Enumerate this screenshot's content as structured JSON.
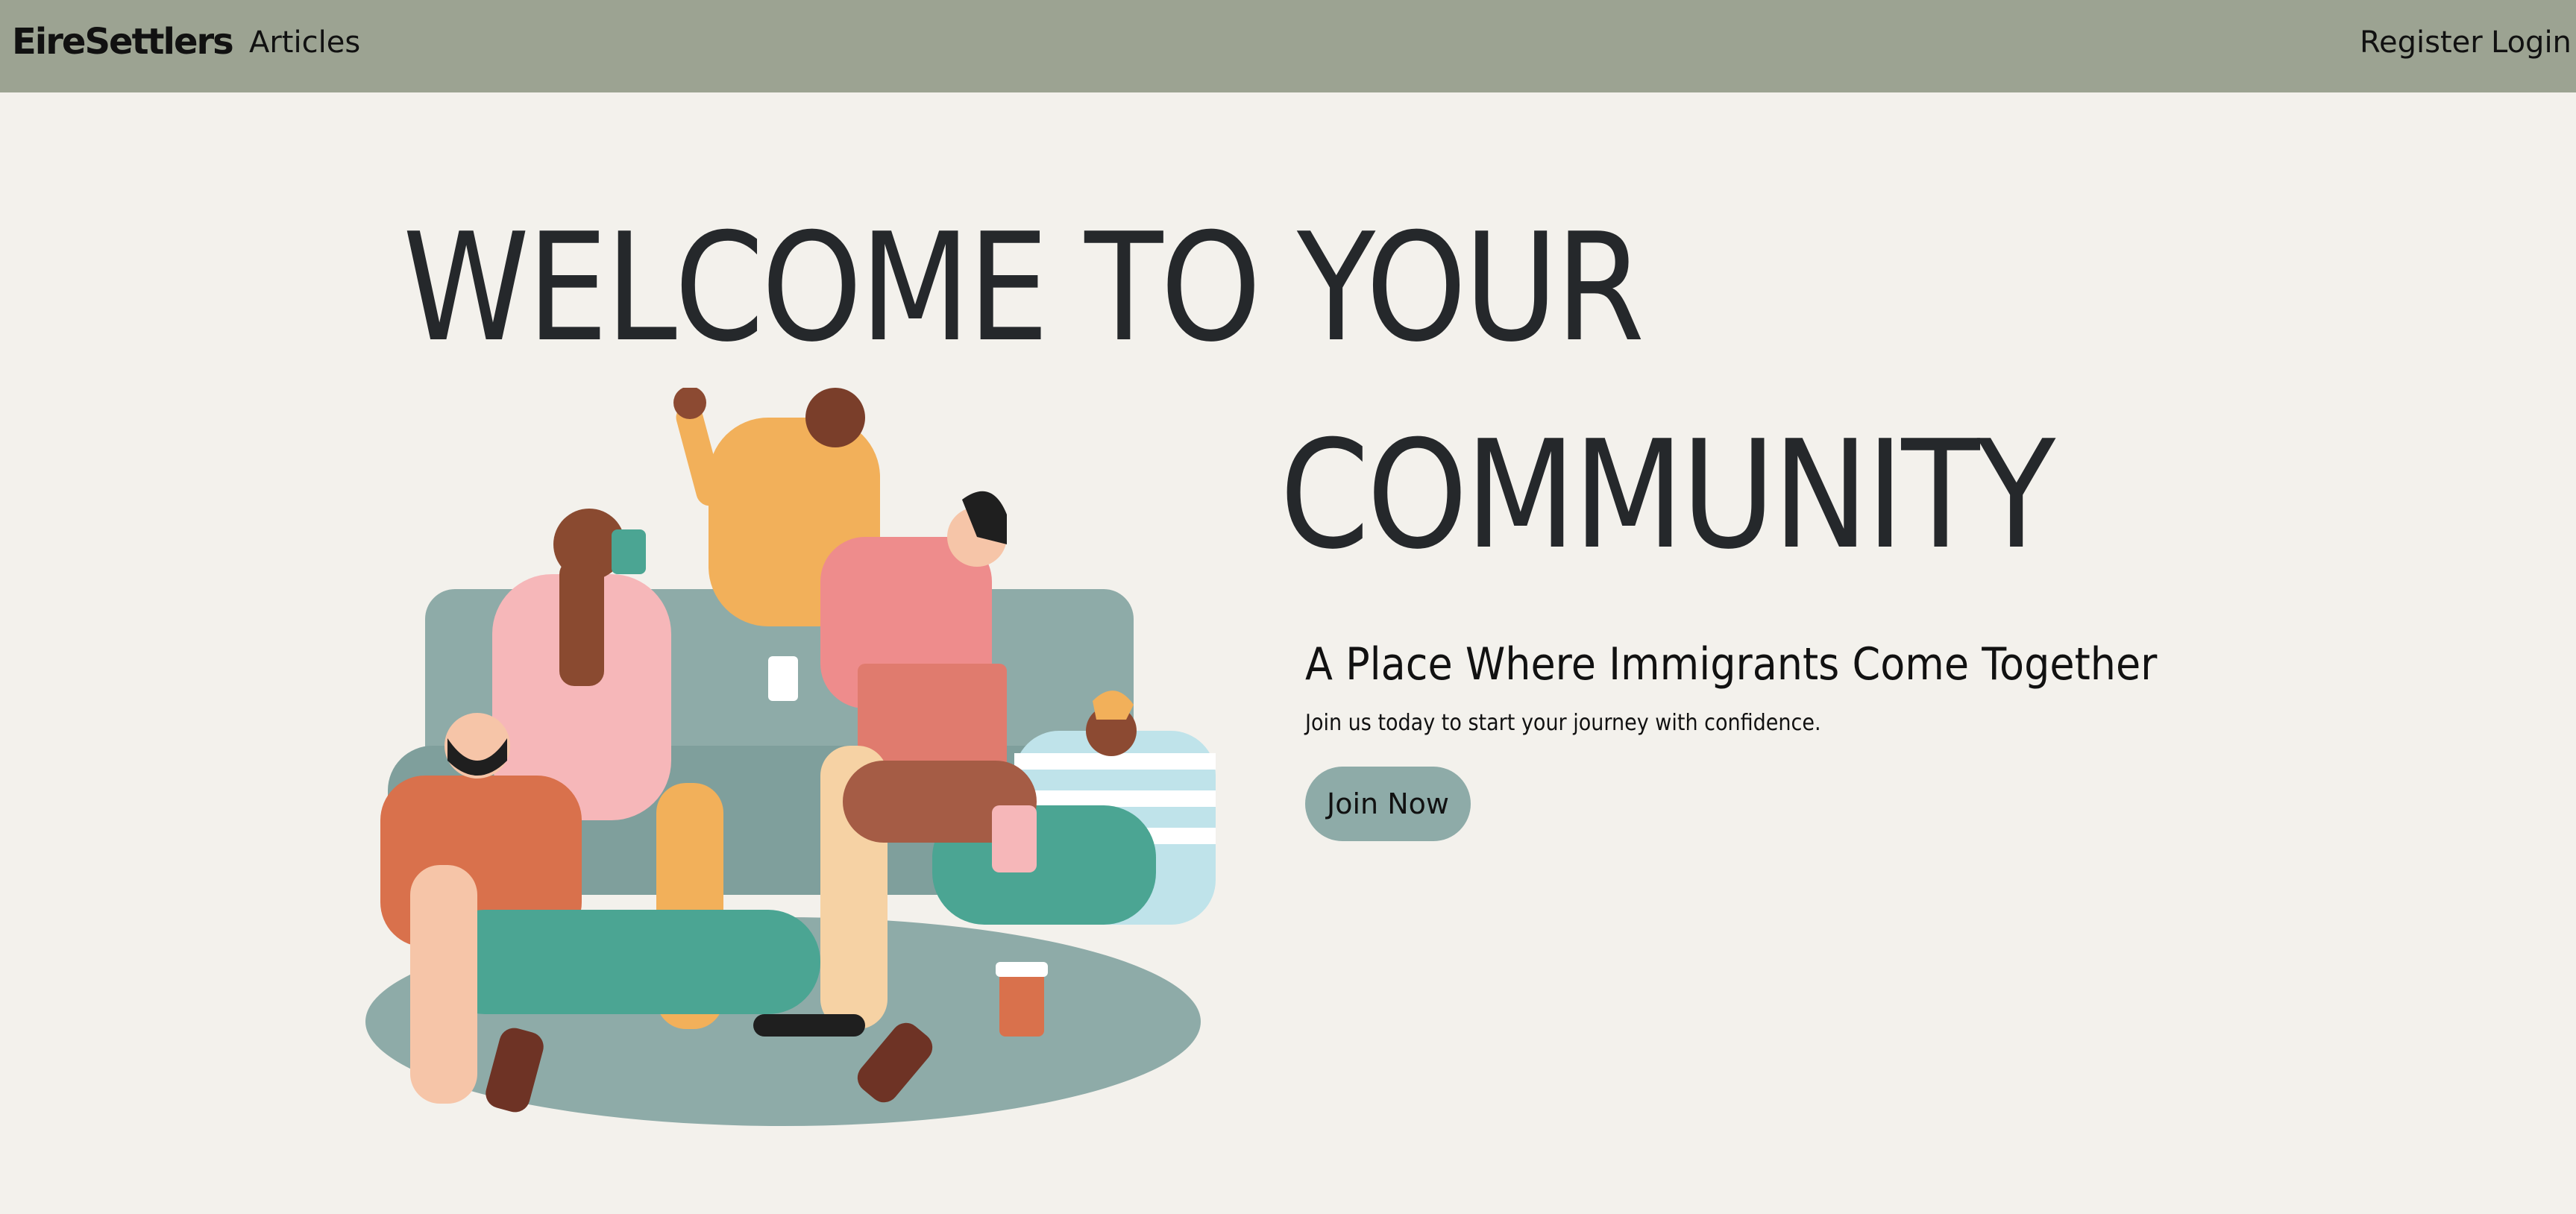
{
  "nav": {
    "brand": "EireSettlers",
    "articles_label": "Articles",
    "register_label": "Register",
    "login_label": "Login"
  },
  "hero": {
    "headline_line1": "WELCOME TO YOUR",
    "headline_line2": "COMMUNITY",
    "subtitle": "A Place Where Immigrants Come Together",
    "tagline": "Join us today to start your journey with confidence.",
    "cta_label": "Join Now",
    "illustration": "group-of-people-on-couch-illustration"
  },
  "colors": {
    "navbar_bg": "#9ca392",
    "page_bg": "#f3f1ec",
    "headline": "#25282b",
    "button_bg": "#8eaba8",
    "couch": "#8eaba8",
    "yellow_shirt": "#f2b05a",
    "pink_shirt": "#f6b7b9",
    "coral_shirt": "#ee8c8c",
    "teal_pants": "#4ba593",
    "rust_shirt": "#d9714c"
  }
}
